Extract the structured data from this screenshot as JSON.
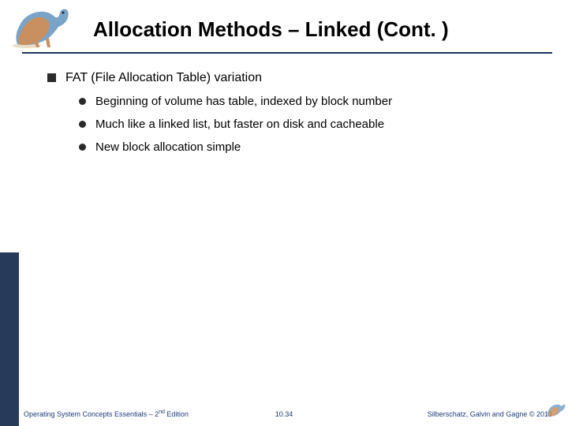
{
  "title": "Allocation Methods – Linked (Cont. )",
  "bullets": {
    "main": "FAT (File Allocation Table) variation",
    "subs": [
      "Beginning of volume has table, indexed by block number",
      "Much like a linked list, but faster on disk and cacheable",
      "New block allocation simple"
    ]
  },
  "footer": {
    "left_a": "Operating System Concepts Essentials – 2",
    "left_b": " Edition",
    "left_sup": "nd",
    "center": "10.34",
    "right": "Silberschatz, Galvin and Gagne © 2013"
  }
}
